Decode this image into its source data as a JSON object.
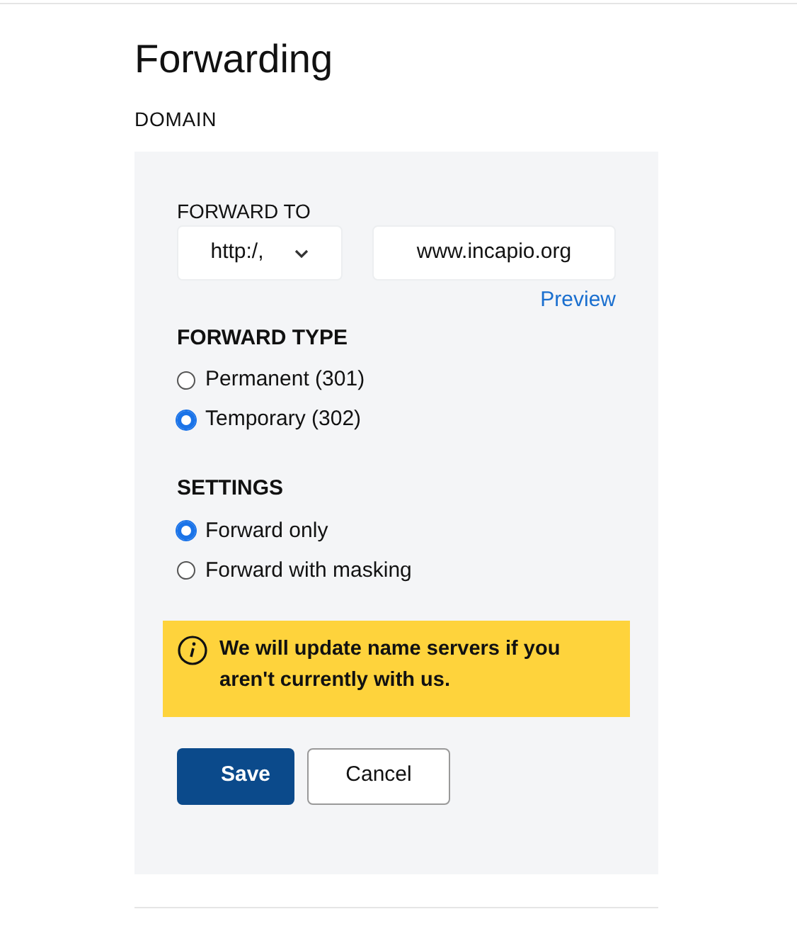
{
  "page": {
    "title": "Forwarding",
    "section": "DOMAIN"
  },
  "forward_to": {
    "label": "FORWARD TO",
    "protocol": "http:/,",
    "url": "www.incapio.org",
    "preview": "Preview"
  },
  "forward_type": {
    "heading": "FORWARD TYPE",
    "options": [
      {
        "label": "Permanent (301)",
        "selected": false
      },
      {
        "label": "Temporary (302)",
        "selected": true
      }
    ]
  },
  "settings": {
    "heading": "SETTINGS",
    "options": [
      {
        "label": "Forward only",
        "selected": true
      },
      {
        "label": "Forward with masking",
        "selected": false
      }
    ]
  },
  "notice": "We will update name servers if you aren't currently with us.",
  "buttons": [
    {
      "label": "Save",
      "kind": "primary"
    },
    {
      "label": "Cancel",
      "kind": "secondary"
    }
  ]
}
